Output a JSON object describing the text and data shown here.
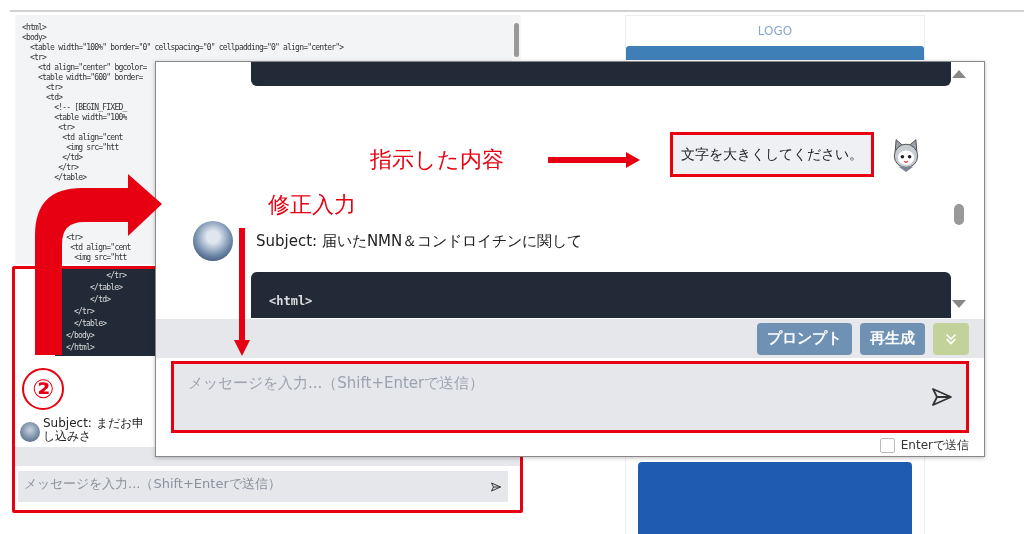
{
  "editor": {
    "lines": [
      "<html>",
      "<body>",
      "  <table width=\"100%\" border=\"0\" cellspacing=\"0\" cellpadding=\"0\" align=\"center\">",
      "  <tr>",
      "    <td align=\"center\" bgcolor=",
      "    <table width=\"600\" border=",
      "      <tr>",
      "      <td>",
      "        <!-- [BEGIN_FIXED_",
      "        <table width=\"100%",
      "         <tr>",
      "          <td align=\"cent",
      "           <img src=\"htt",
      "          </td>",
      "         </tr>",
      "        </table>"
    ],
    "lines_lower": [
      "           <tr>",
      "            <td align=\"cent",
      "             <img src=\"htt"
    ]
  },
  "background_chat": {
    "code_lines": [
      "          </tr>",
      "      </table>",
      "      </td>",
      "  </tr>",
      "  </table>",
      "</body>",
      "</html>"
    ],
    "message": "Subject: まだお申し込みさ",
    "input": {
      "placeholder": "メッセージを入力...（Shift+Enterで送信）"
    }
  },
  "preview": {
    "logo": "LOGO"
  },
  "chat_window": {
    "messages": [
      {
        "kind": "code"
      },
      {
        "kind": "user",
        "text": "文字を大きくしてください。"
      },
      {
        "kind": "assistant",
        "text": "Subject: 届いたNMN＆コンドロイチンに関して"
      },
      {
        "kind": "code",
        "text": "<html>"
      }
    ],
    "buttons": [
      {
        "label": "プロンプト"
      },
      {
        "label": "再生成"
      }
    ],
    "input": {
      "placeholder": "メッセージを入力...（Shift+Enterで送信）"
    },
    "enter_to_send": {
      "label": "Enterで送信",
      "checked": false
    }
  },
  "annotations": {
    "step_number": "②",
    "instruction_label": "指示した内容",
    "correction_label": "修正入力"
  }
}
